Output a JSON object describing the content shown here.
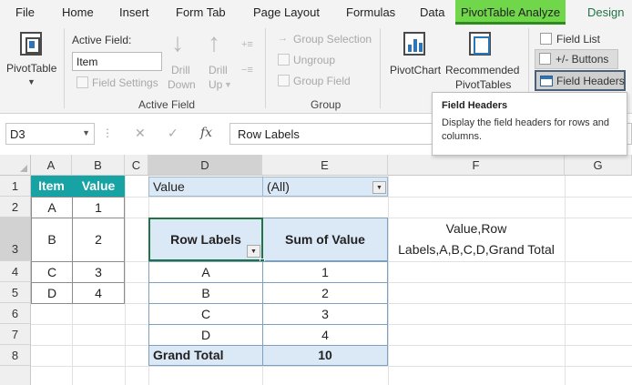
{
  "menu": {
    "tabs": [
      {
        "label": "File"
      },
      {
        "label": "Home"
      },
      {
        "label": "Insert"
      },
      {
        "label": "Form Tab"
      },
      {
        "label": "Page Layout"
      },
      {
        "label": "Formulas"
      },
      {
        "label": "Data"
      },
      {
        "label": "PivotTable Analyze",
        "active": true
      },
      {
        "label": "Design"
      }
    ]
  },
  "ribbon": {
    "pivottable_label": "PivotTable",
    "active_field": {
      "title": "Active Field:",
      "value": "Item",
      "field_settings": "Field Settings",
      "drill_down_1": "Drill",
      "drill_down_2": "Down",
      "drill_up_1": "Drill",
      "drill_up_2": "Up",
      "group_caption": "Active Field"
    },
    "group": {
      "group_selection": "Group Selection",
      "ungroup": "Ungroup",
      "group_field": "Group Field",
      "group_caption": "Group"
    },
    "pivotchart_label": "PivotChart",
    "recommended_1": "Recommended",
    "recommended_2": "PivotTables",
    "show": {
      "field_list": "Field List",
      "buttons": "+/- Buttons",
      "field_headers": "Field Headers"
    },
    "colors": {
      "active_tab": "#70d64a",
      "design_tab": "#217346"
    }
  },
  "tooltip": {
    "title": "Field Headers",
    "body": "Display the field headers for rows and columns."
  },
  "formula_bar": {
    "name_box": "D3",
    "formula": "Row Labels",
    "fx_symbol": "fx"
  },
  "grid": {
    "columns": [
      "A",
      "B",
      "C",
      "D",
      "E",
      "F",
      "G"
    ],
    "rows": [
      "1",
      "2",
      "3",
      "4",
      "5",
      "6",
      "7",
      "8"
    ],
    "source_table": {
      "headers": [
        "Item",
        "Value"
      ],
      "rows": [
        [
          "A",
          "1"
        ],
        [
          "B",
          "2"
        ],
        [
          "C",
          "3"
        ],
        [
          "D",
          "4"
        ]
      ],
      "header_color": "#17a2a3"
    },
    "pivot_filter": {
      "label": "Value",
      "value": "(All)"
    },
    "pivot_table": {
      "row_labels_header": "Row Labels",
      "values_header": "Sum of Value",
      "rows": [
        [
          "A",
          "1"
        ],
        [
          "B",
          "2"
        ],
        [
          "C",
          "3"
        ],
        [
          "D",
          "4"
        ]
      ],
      "grand_total_label": "Grand Total",
      "grand_total_value": "10"
    },
    "f3_text_line1": "Value,Row",
    "f3_text_line2": "Labels,A,B,C,D,Grand Total"
  }
}
